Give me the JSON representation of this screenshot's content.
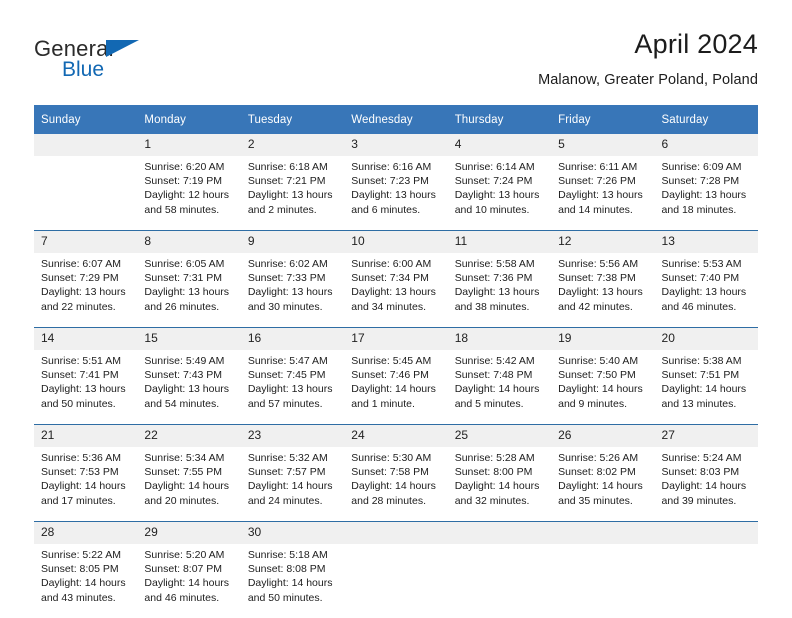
{
  "brand": {
    "name_top": "General",
    "name_bottom": "Blue",
    "triangle_icon": "blue-triangle-icon",
    "accent_color": "#1268b3"
  },
  "header": {
    "title": "April 2024",
    "subtitle": "Malanow, Greater Poland, Poland"
  },
  "calendar": {
    "header_bg": "#3876b8",
    "header_text_color": "#ffffff",
    "daynum_bg": "#f0f0f0",
    "row_separator_color": "#2e6da4",
    "weekdays": [
      "Sunday",
      "Monday",
      "Tuesday",
      "Wednesday",
      "Thursday",
      "Friday",
      "Saturday"
    ],
    "weeks": [
      [
        {
          "day": "",
          "lines": []
        },
        {
          "day": "1",
          "lines": [
            "Sunrise: 6:20 AM",
            "Sunset: 7:19 PM",
            "Daylight: 12 hours",
            "and 58 minutes."
          ]
        },
        {
          "day": "2",
          "lines": [
            "Sunrise: 6:18 AM",
            "Sunset: 7:21 PM",
            "Daylight: 13 hours",
            "and 2 minutes."
          ]
        },
        {
          "day": "3",
          "lines": [
            "Sunrise: 6:16 AM",
            "Sunset: 7:23 PM",
            "Daylight: 13 hours",
            "and 6 minutes."
          ]
        },
        {
          "day": "4",
          "lines": [
            "Sunrise: 6:14 AM",
            "Sunset: 7:24 PM",
            "Daylight: 13 hours",
            "and 10 minutes."
          ]
        },
        {
          "day": "5",
          "lines": [
            "Sunrise: 6:11 AM",
            "Sunset: 7:26 PM",
            "Daylight: 13 hours",
            "and 14 minutes."
          ]
        },
        {
          "day": "6",
          "lines": [
            "Sunrise: 6:09 AM",
            "Sunset: 7:28 PM",
            "Daylight: 13 hours",
            "and 18 minutes."
          ]
        }
      ],
      [
        {
          "day": "7",
          "lines": [
            "Sunrise: 6:07 AM",
            "Sunset: 7:29 PM",
            "Daylight: 13 hours",
            "and 22 minutes."
          ]
        },
        {
          "day": "8",
          "lines": [
            "Sunrise: 6:05 AM",
            "Sunset: 7:31 PM",
            "Daylight: 13 hours",
            "and 26 minutes."
          ]
        },
        {
          "day": "9",
          "lines": [
            "Sunrise: 6:02 AM",
            "Sunset: 7:33 PM",
            "Daylight: 13 hours",
            "and 30 minutes."
          ]
        },
        {
          "day": "10",
          "lines": [
            "Sunrise: 6:00 AM",
            "Sunset: 7:34 PM",
            "Daylight: 13 hours",
            "and 34 minutes."
          ]
        },
        {
          "day": "11",
          "lines": [
            "Sunrise: 5:58 AM",
            "Sunset: 7:36 PM",
            "Daylight: 13 hours",
            "and 38 minutes."
          ]
        },
        {
          "day": "12",
          "lines": [
            "Sunrise: 5:56 AM",
            "Sunset: 7:38 PM",
            "Daylight: 13 hours",
            "and 42 minutes."
          ]
        },
        {
          "day": "13",
          "lines": [
            "Sunrise: 5:53 AM",
            "Sunset: 7:40 PM",
            "Daylight: 13 hours",
            "and 46 minutes."
          ]
        }
      ],
      [
        {
          "day": "14",
          "lines": [
            "Sunrise: 5:51 AM",
            "Sunset: 7:41 PM",
            "Daylight: 13 hours",
            "and 50 minutes."
          ]
        },
        {
          "day": "15",
          "lines": [
            "Sunrise: 5:49 AM",
            "Sunset: 7:43 PM",
            "Daylight: 13 hours",
            "and 54 minutes."
          ]
        },
        {
          "day": "16",
          "lines": [
            "Sunrise: 5:47 AM",
            "Sunset: 7:45 PM",
            "Daylight: 13 hours",
            "and 57 minutes."
          ]
        },
        {
          "day": "17",
          "lines": [
            "Sunrise: 5:45 AM",
            "Sunset: 7:46 PM",
            "Daylight: 14 hours",
            "and 1 minute."
          ]
        },
        {
          "day": "18",
          "lines": [
            "Sunrise: 5:42 AM",
            "Sunset: 7:48 PM",
            "Daylight: 14 hours",
            "and 5 minutes."
          ]
        },
        {
          "day": "19",
          "lines": [
            "Sunrise: 5:40 AM",
            "Sunset: 7:50 PM",
            "Daylight: 14 hours",
            "and 9 minutes."
          ]
        },
        {
          "day": "20",
          "lines": [
            "Sunrise: 5:38 AM",
            "Sunset: 7:51 PM",
            "Daylight: 14 hours",
            "and 13 minutes."
          ]
        }
      ],
      [
        {
          "day": "21",
          "lines": [
            "Sunrise: 5:36 AM",
            "Sunset: 7:53 PM",
            "Daylight: 14 hours",
            "and 17 minutes."
          ]
        },
        {
          "day": "22",
          "lines": [
            "Sunrise: 5:34 AM",
            "Sunset: 7:55 PM",
            "Daylight: 14 hours",
            "and 20 minutes."
          ]
        },
        {
          "day": "23",
          "lines": [
            "Sunrise: 5:32 AM",
            "Sunset: 7:57 PM",
            "Daylight: 14 hours",
            "and 24 minutes."
          ]
        },
        {
          "day": "24",
          "lines": [
            "Sunrise: 5:30 AM",
            "Sunset: 7:58 PM",
            "Daylight: 14 hours",
            "and 28 minutes."
          ]
        },
        {
          "day": "25",
          "lines": [
            "Sunrise: 5:28 AM",
            "Sunset: 8:00 PM",
            "Daylight: 14 hours",
            "and 32 minutes."
          ]
        },
        {
          "day": "26",
          "lines": [
            "Sunrise: 5:26 AM",
            "Sunset: 8:02 PM",
            "Daylight: 14 hours",
            "and 35 minutes."
          ]
        },
        {
          "day": "27",
          "lines": [
            "Sunrise: 5:24 AM",
            "Sunset: 8:03 PM",
            "Daylight: 14 hours",
            "and 39 minutes."
          ]
        }
      ],
      [
        {
          "day": "28",
          "lines": [
            "Sunrise: 5:22 AM",
            "Sunset: 8:05 PM",
            "Daylight: 14 hours",
            "and 43 minutes."
          ]
        },
        {
          "day": "29",
          "lines": [
            "Sunrise: 5:20 AM",
            "Sunset: 8:07 PM",
            "Daylight: 14 hours",
            "and 46 minutes."
          ]
        },
        {
          "day": "30",
          "lines": [
            "Sunrise: 5:18 AM",
            "Sunset: 8:08 PM",
            "Daylight: 14 hours",
            "and 50 minutes."
          ]
        },
        {
          "day": "",
          "lines": []
        },
        {
          "day": "",
          "lines": []
        },
        {
          "day": "",
          "lines": []
        },
        {
          "day": "",
          "lines": []
        }
      ]
    ]
  }
}
